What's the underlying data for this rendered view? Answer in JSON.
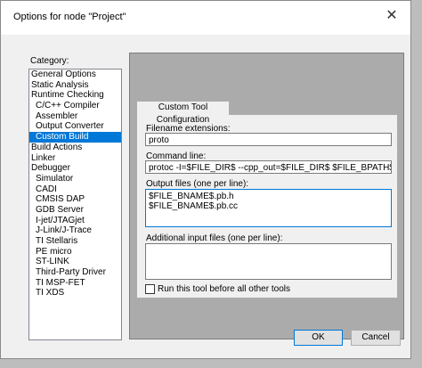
{
  "window": {
    "title": "Options for node \"Project\"",
    "close_glyph": "✕"
  },
  "sidebar": {
    "label": "Category:",
    "items": [
      {
        "label": "General Options",
        "level": 0
      },
      {
        "label": "Static Analysis",
        "level": 0
      },
      {
        "label": "Runtime Checking",
        "level": 0
      },
      {
        "label": "C/C++ Compiler",
        "level": 1
      },
      {
        "label": "Assembler",
        "level": 1
      },
      {
        "label": "Output Converter",
        "level": 1
      },
      {
        "label": "Custom Build",
        "level": 1,
        "selected": true
      },
      {
        "label": "Build Actions",
        "level": 0
      },
      {
        "label": "Linker",
        "level": 0
      },
      {
        "label": "Debugger",
        "level": 0
      },
      {
        "label": "Simulator",
        "level": 1
      },
      {
        "label": "CADI",
        "level": 1
      },
      {
        "label": "CMSIS DAP",
        "level": 1
      },
      {
        "label": "GDB Server",
        "level": 1
      },
      {
        "label": "I-jet/JTAGjet",
        "level": 1
      },
      {
        "label": "J-Link/J-Trace",
        "level": 1
      },
      {
        "label": "TI Stellaris",
        "level": 1
      },
      {
        "label": "PE micro",
        "level": 1
      },
      {
        "label": "ST-LINK",
        "level": 1
      },
      {
        "label": "Third-Party Driver",
        "level": 1
      },
      {
        "label": "TI MSP-FET",
        "level": 1
      },
      {
        "label": "TI XDS",
        "level": 1
      }
    ]
  },
  "tab": {
    "label": "Custom Tool Configuration"
  },
  "form": {
    "filename_ext_label": "Filename extensions:",
    "filename_ext_value": "proto",
    "command_line_label": "Command line:",
    "command_line_value": "protoc -I=$FILE_DIR$ --cpp_out=$FILE_DIR$ $FILE_BPATH$",
    "output_files_label": "Output files (one per line):",
    "output_files_lines": [
      "$FILE_BNAME$.pb.h",
      "$FILE_BNAME$.pb.cc"
    ],
    "additional_input_label": "Additional input files (one per line):",
    "additional_input_value": "",
    "run_before_label": "Run this tool before all other tools",
    "run_before_checked": false
  },
  "footer": {
    "ok_label": "OK",
    "cancel_label": "Cancel"
  },
  "colors": {
    "selection": "#0078d7",
    "dialog_bg": "#f0f0f0",
    "content_bg": "#ababab"
  }
}
